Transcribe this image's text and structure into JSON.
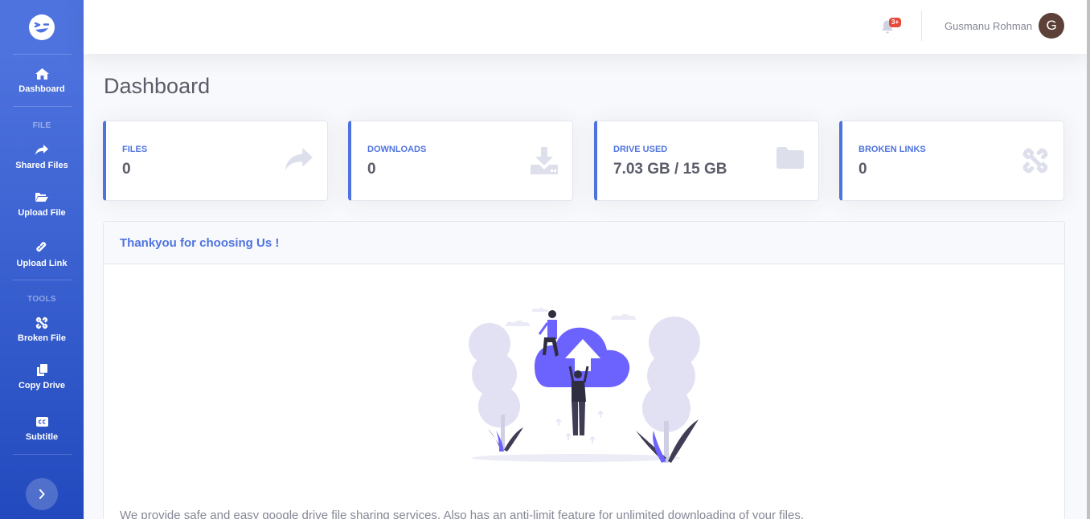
{
  "sidebar": {
    "brand_icon": "winking-face-icon",
    "items": [
      {
        "label": "Dashboard",
        "icon": "home-icon"
      },
      {
        "label": "Shared Files",
        "icon": "share-icon"
      },
      {
        "label": "Upload File",
        "icon": "folder-open-icon"
      },
      {
        "label": "Upload Link",
        "icon": "link-icon"
      },
      {
        "label": "Broken File",
        "icon": "unlink-icon"
      },
      {
        "label": "Copy Drive",
        "icon": "copy-icon"
      },
      {
        "label": "Subtitle",
        "icon": "closed-captioning-icon"
      }
    ],
    "headings": {
      "file": "FILE",
      "tools": "TOOLS"
    },
    "toggle_icon": "chevron-right-icon"
  },
  "topbar": {
    "notification_badge": "3+",
    "user_name": "Gusmanu Rohman",
    "avatar_initial": "G"
  },
  "page": {
    "title": "Dashboard"
  },
  "cards": [
    {
      "label": "FILES",
      "value": "0",
      "icon": "share-icon"
    },
    {
      "label": "DOWNLOADS",
      "value": "0",
      "icon": "download-icon"
    },
    {
      "label": "DRIVE USED",
      "value": "7.03 GB / 15 GB",
      "icon": "folder-icon"
    },
    {
      "label": "BROKEN LINKS",
      "value": "0",
      "icon": "unlink-icon"
    }
  ],
  "panel": {
    "title": "Thankyou for choosing Us !",
    "text": "We provide safe and easy google drive file sharing services. Also has an anti-limit feature for unlimited downloading of your files."
  },
  "colors": {
    "primary": "#4e73df",
    "primary_dark": "#224abe",
    "background": "#f8f9fc",
    "text": "#858796",
    "heading_text": "#5a5c69",
    "card_icon": "#dddfeb",
    "badge": "#e74a3b",
    "illustration_purple": "#6c63ff",
    "avatar_bg": "#5d4037"
  }
}
